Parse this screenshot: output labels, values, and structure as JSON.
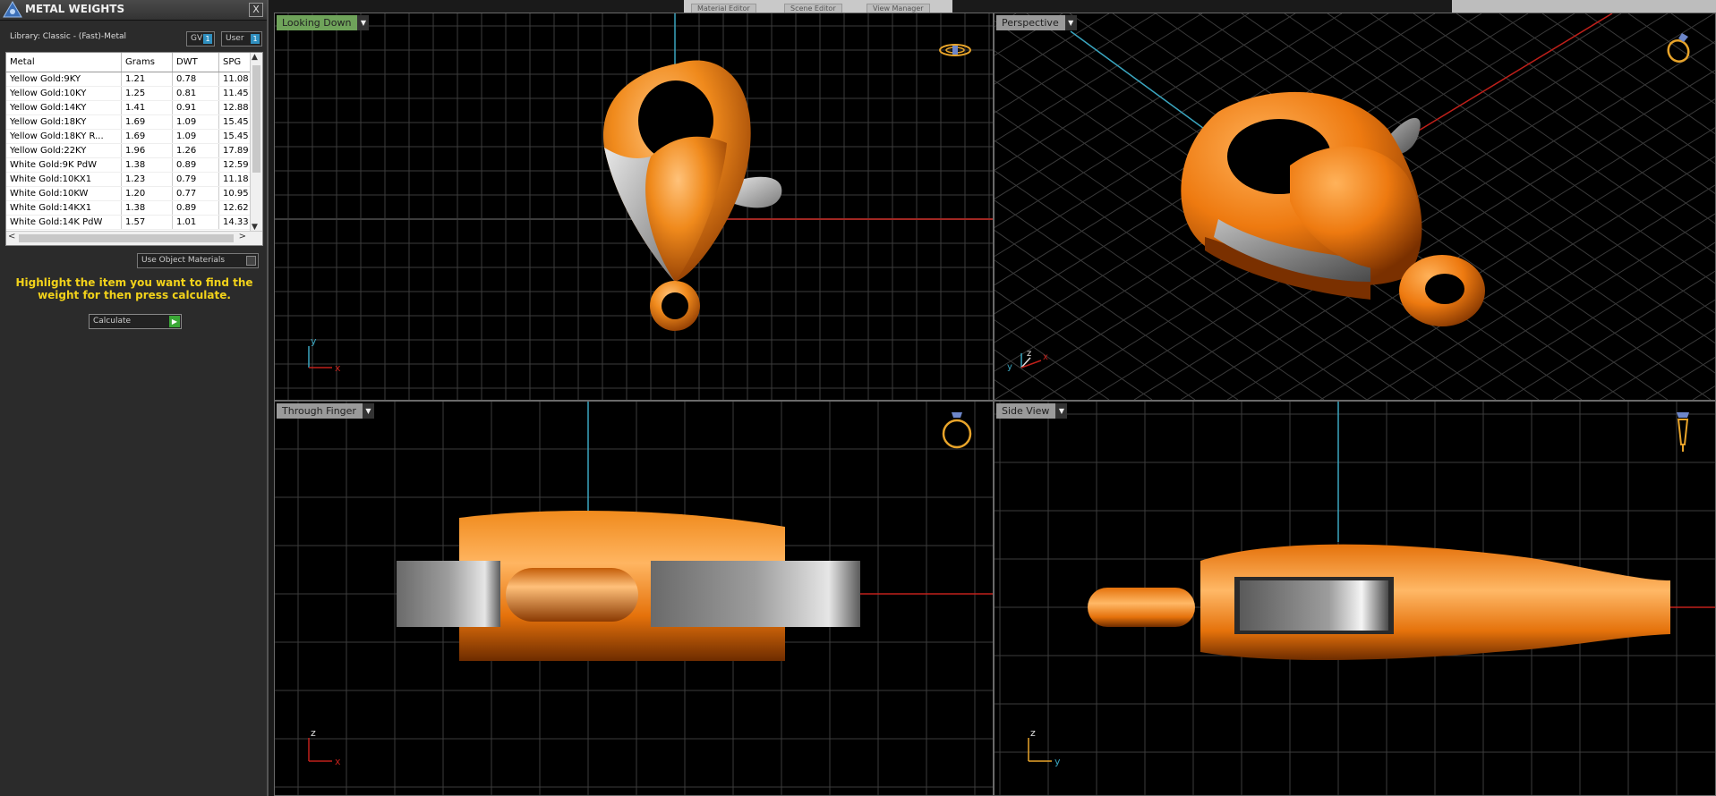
{
  "panel": {
    "title": "METAL WEIGHTS",
    "close_label": "X",
    "library": "Library: Classic - (Fast)-Metal",
    "toggle_gv": {
      "label": "GV",
      "indicator": "1"
    },
    "toggle_user": {
      "label": "User",
      "indicator": "1"
    },
    "table": {
      "columns": [
        "Metal",
        "Grams",
        "DWT",
        "SPG"
      ],
      "rows": [
        [
          "Yellow Gold:9KY",
          "1.21",
          "0.78",
          "11.08"
        ],
        [
          "Yellow Gold:10KY",
          "1.25",
          "0.81",
          "11.45"
        ],
        [
          "Yellow Gold:14KY",
          "1.41",
          "0.91",
          "12.88"
        ],
        [
          "Yellow Gold:18KY",
          "1.69",
          "1.09",
          "15.45"
        ],
        [
          "Yellow Gold:18KY R...",
          "1.69",
          "1.09",
          "15.45"
        ],
        [
          "Yellow Gold:22KY",
          "1.96",
          "1.26",
          "17.89"
        ],
        [
          "White Gold:9K PdW",
          "1.38",
          "0.89",
          "12.59"
        ],
        [
          "White Gold:10KX1",
          "1.23",
          "0.79",
          "11.18"
        ],
        [
          "White Gold:10KW",
          "1.20",
          "0.77",
          "10.95"
        ],
        [
          "White Gold:14KX1",
          "1.38",
          "0.89",
          "12.62"
        ],
        [
          "White Gold:14K PdW",
          "1.57",
          "1.01",
          "14.33"
        ]
      ]
    },
    "use_object_materials": "Use Object Materials",
    "hint": "Highlight the item you want to find the weight for then press calculate.",
    "calculate_label": "Calculate",
    "calculate_icon": "play-icon"
  },
  "top_tabs": [
    "Material Editor",
    "Scene Editor",
    "View Manager"
  ],
  "viewports": {
    "top_left": {
      "label": "Looking Down",
      "label_color": "#6fa35a",
      "axes": [
        "y",
        "x"
      ]
    },
    "top_right": {
      "label": "Perspective",
      "label_color": "#9a9a9a",
      "axes": [
        "y",
        "z",
        "x"
      ]
    },
    "bottom_left": {
      "label": "Through Finger",
      "label_color": "#9a9a9a",
      "axes": [
        "z",
        "x"
      ]
    },
    "bottom_right": {
      "label": "Side View",
      "label_color": "#9a9a9a",
      "axes": [
        "z",
        "y"
      ]
    }
  },
  "colors": {
    "metal_orange": "#e8730f",
    "metal_gray": "#8a8a8a",
    "grid": "#3c3c3c",
    "axis_red": "#c0201a",
    "axis_cyan": "#3aa6c0",
    "hint_yellow": "#f2d21a"
  }
}
